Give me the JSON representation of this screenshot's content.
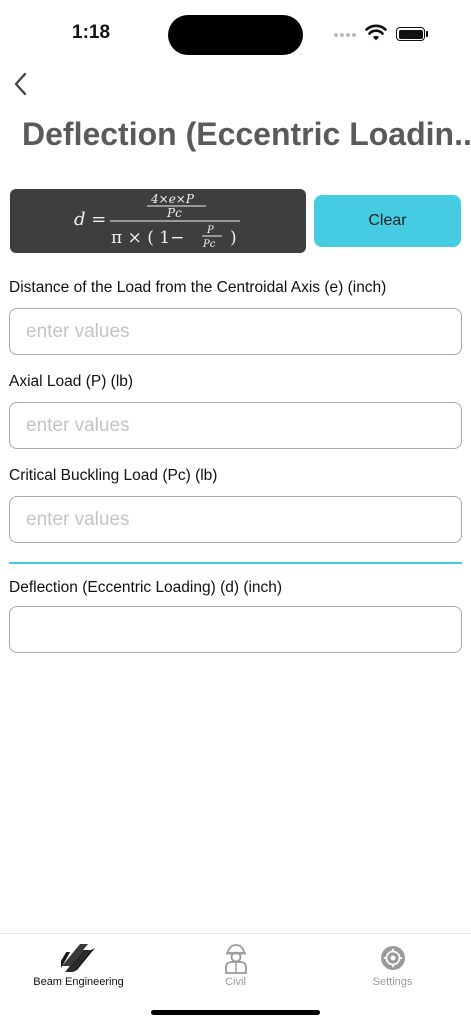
{
  "status": {
    "time": "1:18"
  },
  "nav": {
    "back_icon": "chevron-left-icon"
  },
  "page": {
    "title": "Deflection (Eccentric Loadin..."
  },
  "formula": {
    "lhs": "d =",
    "numerator_top": "4×e×P",
    "numerator_bottom": "Pc",
    "denominator_prefix": "π × ( 1−",
    "frac_top": "P",
    "frac_bottom": "Pc",
    "denominator_suffix": ")"
  },
  "actions": {
    "clear_label": "Clear"
  },
  "fields": [
    {
      "label": "Distance of the Load from the Centroidal Axis (e) (inch)",
      "placeholder": "enter values",
      "value": ""
    },
    {
      "label": "Axial Load (P) (lb)",
      "placeholder": "enter values",
      "value": ""
    },
    {
      "label": "Critical Buckling Load (Pc) (lb)",
      "placeholder": "enter values",
      "value": ""
    }
  ],
  "result": {
    "label": "Deflection (Eccentric Loading) (d) (inch)",
    "value": ""
  },
  "tabs": [
    {
      "label": "Beam Engineering",
      "icon": "i-beam-icon",
      "active": true
    },
    {
      "label": "Civil",
      "icon": "worker-icon",
      "active": false
    },
    {
      "label": "Settings",
      "icon": "gear-icon",
      "active": false
    }
  ],
  "colors": {
    "accent": "#45cbe2",
    "formula_bg": "#3e3e3e",
    "title": "#5a5a5a"
  }
}
